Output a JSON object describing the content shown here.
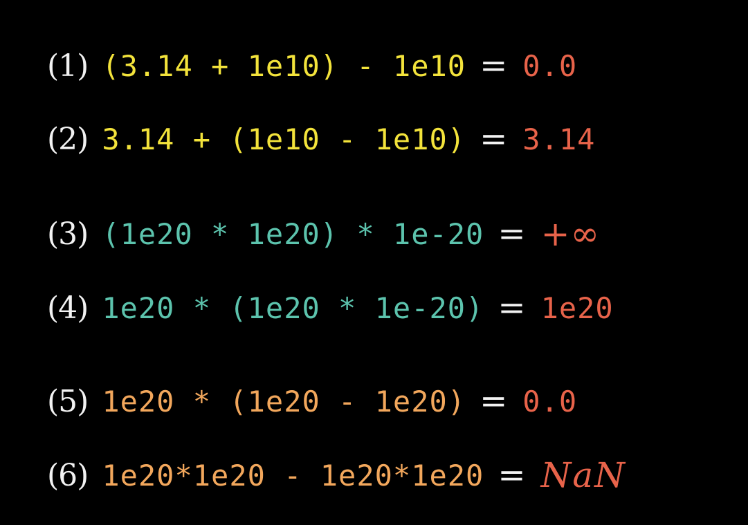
{
  "colors": {
    "index": "#f2f2f2",
    "group_1_2": "#f3e33b",
    "group_3_4": "#5cc3ad",
    "group_5_6": "#f2a75c",
    "result": "#e8634a",
    "heading_fragment": "#2f9ed8"
  },
  "equations": [
    {
      "index": "(1)",
      "expr": "(3.14 + 1e10) - 1e10",
      "eq": "=",
      "result": "0.0"
    },
    {
      "index": "(2)",
      "expr": "3.14 + (1e10 - 1e10)",
      "eq": "=",
      "result": "3.14"
    },
    {
      "index": "(3)",
      "expr": "(1e20 * 1e20) * 1e-20",
      "eq": "=",
      "result": "+∞"
    },
    {
      "index": "(4)",
      "expr": "1e20 * (1e20 * 1e-20)",
      "eq": "=",
      "result": "1e20"
    },
    {
      "index": "(5)",
      "expr": "1e20 * (1e20 - 1e20)",
      "eq": "=",
      "result": "0.0"
    },
    {
      "index": "(6)",
      "expr": "1e20*1e20 - 1e20*1e20",
      "eq": "=",
      "result": "NaN"
    }
  ]
}
